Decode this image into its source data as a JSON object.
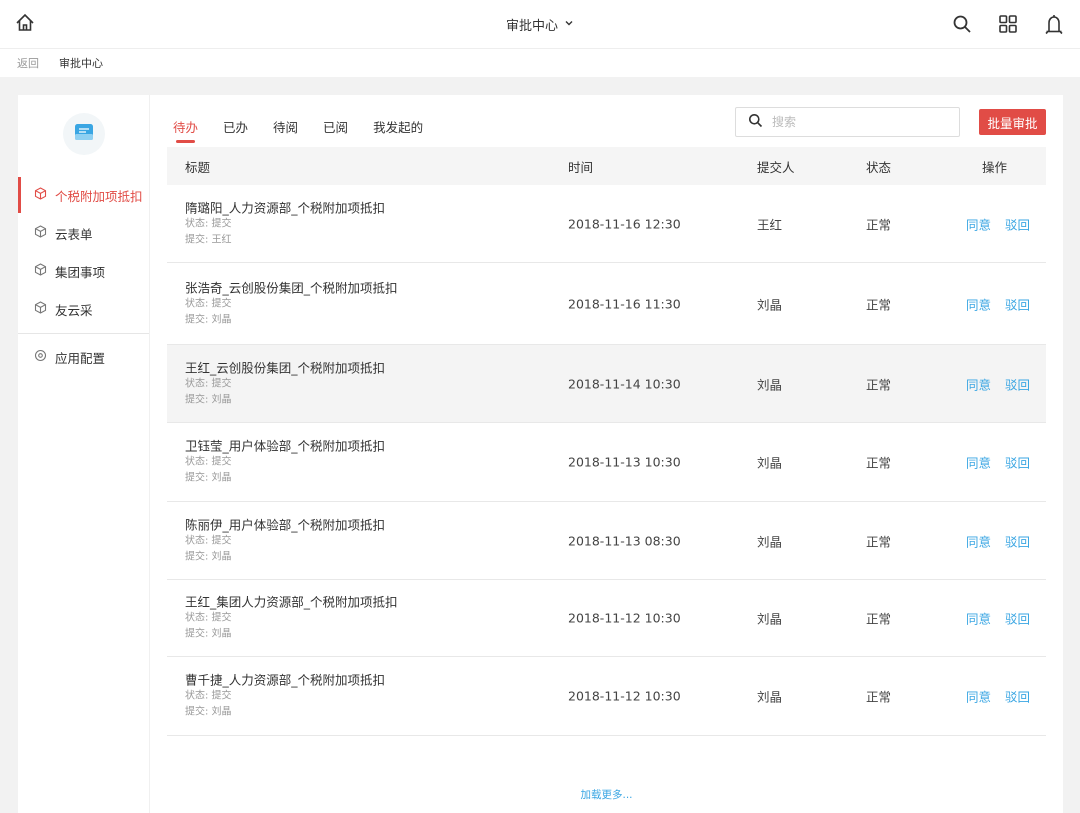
{
  "header": {
    "title": "审批中心",
    "icons": [
      "home-icon",
      "chevron-down-icon",
      "search-icon",
      "apps-grid-icon",
      "bell-icon"
    ]
  },
  "breadcrumb": {
    "back": "返回",
    "current": "审批中心"
  },
  "sidebar": {
    "items": [
      {
        "label": "个税附加项抵扣",
        "active": true
      },
      {
        "label": "云表单"
      },
      {
        "label": "集团事项"
      },
      {
        "label": "友云采"
      },
      {
        "label": "应用配置"
      }
    ]
  },
  "tabs": [
    "待办",
    "已办",
    "待阅",
    "已阅",
    "我发起的"
  ],
  "active_tab": "待办",
  "search": {
    "placeholder": "搜索",
    "value": ""
  },
  "batch_button": "批量审批",
  "table": {
    "headers": {
      "title": "标题",
      "time": "时间",
      "submitter": "提交人",
      "status": "状态",
      "ops": "操作"
    },
    "rows": [
      {
        "title": "隋璐阳_人力资源部_个税附加项抵扣",
        "state_line": "状态: 提交",
        "submit_line": "提交: 王红",
        "time": "2018-11-16 12:30",
        "submitter": "王红",
        "status": "正常",
        "agree": "同意",
        "reject": "驳回"
      },
      {
        "title": "张浩奇_云创股份集团_个税附加项抵扣",
        "state_line": "状态: 提交",
        "submit_line": "提交: 刘晶",
        "time": "2018-11-16 11:30",
        "submitter": "刘晶",
        "status": "正常",
        "agree": "同意",
        "reject": "驳回"
      },
      {
        "title": "王红_云创股份集团_个税附加项抵扣",
        "state_line": "状态: 提交",
        "submit_line": "提交: 刘晶",
        "time": "2018-11-14 10:30",
        "submitter": "刘晶",
        "status": "正常",
        "agree": "同意",
        "reject": "驳回"
      },
      {
        "title": "卫钰莹_用户体验部_个税附加项抵扣",
        "state_line": "状态: 提交",
        "submit_line": "提交: 刘晶",
        "time": "2018-11-13 10:30",
        "submitter": "刘晶",
        "status": "正常",
        "agree": "同意",
        "reject": "驳回"
      },
      {
        "title": "陈丽伊_用户体验部_个税附加项抵扣",
        "state_line": "状态: 提交",
        "submit_line": "提交: 刘晶",
        "time": "2018-11-13 08:30",
        "submitter": "刘晶",
        "status": "正常",
        "agree": "同意",
        "reject": "驳回"
      },
      {
        "title": "王红_集团人力资源部_个税附加项抵扣",
        "state_line": "状态: 提交",
        "submit_line": "提交: 刘晶",
        "time": "2018-11-12 10:30",
        "submitter": "刘晶",
        "status": "正常",
        "agree": "同意",
        "reject": "驳回"
      },
      {
        "title": "曹千捷_人力资源部_个税附加项抵扣",
        "state_line": "状态: 提交",
        "submit_line": "提交: 刘晶",
        "time": "2018-11-12 10:30",
        "submitter": "刘晶",
        "status": "正常",
        "agree": "同意",
        "reject": "驳回"
      }
    ]
  },
  "load_more": "加载更多...",
  "colors": {
    "accent": "#e14c46",
    "link": "#3aa6e3",
    "muted": "#999999",
    "avatar_icon": "#3aa6e3"
  }
}
